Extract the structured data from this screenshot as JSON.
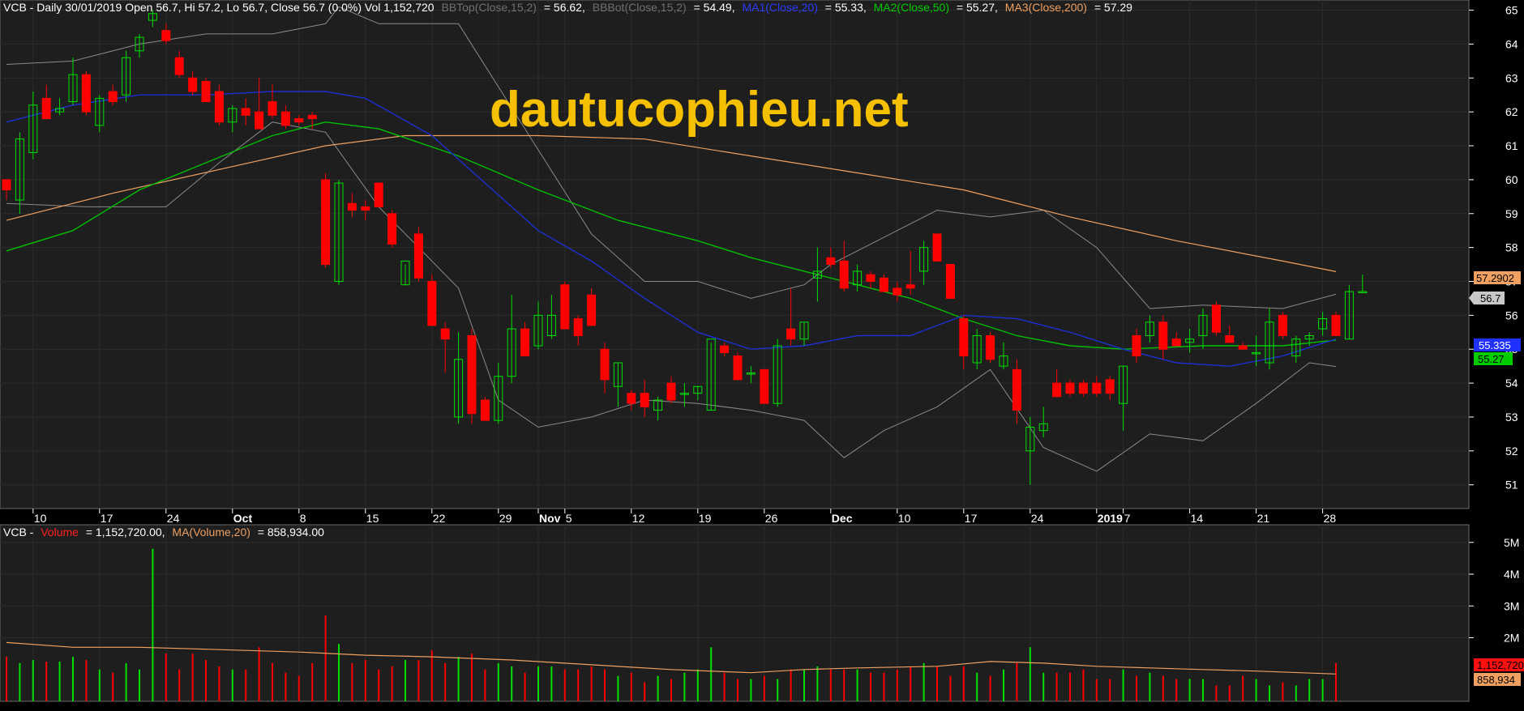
{
  "header": {
    "symbol": "VCB",
    "period": "Daily",
    "date": "30/01/2019",
    "ohlc_text": "VCB - Daily 30/01/2019 Open 56.7, Hi 57.2, Lo 56.7, Close 56.7 (0.0%) Vol 1,152,720",
    "bbtop_label": "BBTop(Close,15,2)",
    "bbtop_value": "= 56.62,",
    "bbbot_label": "BBBot(Close,15,2)",
    "bbbot_value": "= 54.49,",
    "ma1_label": "MA1(Close,20)",
    "ma1_value": "= 55.33,",
    "ma2_label": "MA2(Close,50)",
    "ma2_value": "= 55.27,",
    "ma3_label": "MA3(Close,200)",
    "ma3_value": "= 57.29"
  },
  "volume_header": {
    "prefix": "VCB -",
    "vol_label": "Volume",
    "vol_value": "= 1,152,720.00,",
    "ma_label": "MA(Volume,20)",
    "ma_value": "= 858,934.00"
  },
  "watermark": "dautucophieu.net",
  "badges": {
    "ma3": "57.2902",
    "close": "56.7",
    "ma1": "55.335",
    "ma2": "55.27",
    "vol": "1,152,720",
    "vol_ma": "858,934"
  },
  "colors": {
    "up": "#00e000",
    "down": "#ff0000",
    "ma1": "#1c2fd0",
    "ma2": "#00c000",
    "ma3": "#f0a060",
    "bb": "#8a8a8a",
    "watermark": "#f5c000",
    "badge_ma3": "#f0a060",
    "badge_ma1": "#2030ff",
    "badge_ma2": "#00cc00",
    "badge_close": "#c8c8c8"
  },
  "chart_data": {
    "type": "candlestick",
    "y_ticks": [
      "51",
      "52",
      "53",
      "54",
      "55",
      "56",
      "57",
      "58",
      "59",
      "60",
      "61",
      "62",
      "63",
      "64",
      "65"
    ],
    "y_range": [
      50.3,
      65.3
    ],
    "volume_ticks": [
      "2M",
      "3M",
      "4M",
      "5M"
    ],
    "volume_range": [
      0,
      5300000
    ],
    "x_labels": [
      {
        "i": 2,
        "t": "10"
      },
      {
        "i": 7,
        "t": "17"
      },
      {
        "i": 12,
        "t": "24"
      },
      {
        "i": 17,
        "t": "Oct",
        "bold": true
      },
      {
        "i": 22,
        "t": "8"
      },
      {
        "i": 27,
        "t": "15"
      },
      {
        "i": 32,
        "t": "22"
      },
      {
        "i": 37,
        "t": "29"
      },
      {
        "i": 40,
        "t": "Nov",
        "bold": true
      },
      {
        "i": 42,
        "t": "5"
      },
      {
        "i": 47,
        "t": "12"
      },
      {
        "i": 52,
        "t": "19"
      },
      {
        "i": 57,
        "t": "26"
      },
      {
        "i": 62,
        "t": "Dec",
        "bold": true
      },
      {
        "i": 67,
        "t": "10"
      },
      {
        "i": 72,
        "t": "17"
      },
      {
        "i": 77,
        "t": "24"
      },
      {
        "i": 82,
        "t": "2019",
        "bold": true
      },
      {
        "i": 84,
        "t": "7"
      },
      {
        "i": 89,
        "t": "14"
      },
      {
        "i": 94,
        "t": "21"
      },
      {
        "i": 99,
        "t": "28"
      }
    ],
    "candles": [
      [
        60.0,
        60.0,
        59.4,
        59.7
      ],
      [
        59.4,
        61.4,
        59.0,
        61.2
      ],
      [
        60.8,
        62.6,
        60.6,
        62.2
      ],
      [
        62.4,
        62.8,
        61.8,
        61.8
      ],
      [
        62.0,
        62.4,
        61.9,
        62.1
      ],
      [
        62.3,
        63.6,
        62.2,
        63.1
      ],
      [
        63.1,
        63.2,
        61.9,
        62.0
      ],
      [
        61.6,
        62.5,
        61.4,
        62.4
      ],
      [
        62.6,
        62.8,
        62.2,
        62.3
      ],
      [
        62.5,
        63.8,
        62.3,
        63.6
      ],
      [
        63.8,
        64.3,
        63.6,
        64.2
      ],
      [
        64.7,
        65.0,
        64.5,
        64.9
      ],
      [
        64.4,
        64.6,
        64.0,
        64.1
      ],
      [
        63.6,
        63.8,
        63.0,
        63.1
      ],
      [
        63.0,
        63.2,
        62.5,
        62.6
      ],
      [
        62.9,
        63.0,
        62.3,
        62.3
      ],
      [
        62.6,
        62.8,
        61.6,
        61.7
      ],
      [
        61.7,
        62.2,
        61.4,
        62.1
      ],
      [
        62.1,
        62.4,
        61.6,
        61.9
      ],
      [
        62.0,
        63.0,
        61.5,
        61.5
      ],
      [
        62.3,
        62.8,
        61.8,
        61.9
      ],
      [
        62.0,
        62.2,
        61.5,
        61.6
      ],
      [
        61.8,
        61.9,
        61.6,
        61.7
      ],
      [
        61.9,
        62.0,
        61.5,
        61.8
      ],
      [
        60.0,
        60.2,
        57.4,
        57.5
      ],
      [
        57.0,
        60.0,
        56.9,
        59.9
      ],
      [
        59.3,
        59.6,
        58.9,
        59.1
      ],
      [
        59.2,
        59.4,
        58.8,
        59.1
      ],
      [
        59.9,
        59.9,
        59.2,
        59.2
      ],
      [
        59.0,
        59.1,
        58.0,
        58.1
      ],
      [
        56.9,
        57.5,
        56.9,
        57.6
      ],
      [
        58.4,
        58.6,
        57.0,
        57.1
      ],
      [
        57.0,
        57.2,
        55.7,
        55.7
      ],
      [
        55.6,
        55.8,
        54.3,
        55.3
      ],
      [
        53.0,
        55.5,
        52.8,
        54.7
      ],
      [
        55.4,
        55.6,
        52.8,
        53.1
      ],
      [
        53.5,
        53.6,
        52.9,
        52.9
      ],
      [
        52.9,
        54.6,
        52.8,
        54.2
      ],
      [
        54.2,
        56.6,
        54.0,
        55.6
      ],
      [
        55.6,
        55.8,
        54.8,
        54.8
      ],
      [
        55.1,
        56.4,
        55.0,
        56.0
      ],
      [
        55.4,
        56.6,
        55.3,
        56.0
      ],
      [
        56.9,
        57.0,
        55.6,
        55.6
      ],
      [
        55.9,
        56.0,
        55.1,
        55.4
      ],
      [
        56.6,
        56.8,
        55.7,
        55.7
      ],
      [
        55.0,
        55.2,
        53.7,
        54.1
      ],
      [
        53.9,
        54.6,
        53.3,
        54.6
      ],
      [
        53.7,
        53.8,
        53.2,
        53.4
      ],
      [
        53.7,
        54.1,
        53.0,
        53.3
      ],
      [
        53.2,
        53.6,
        52.9,
        53.5
      ],
      [
        54.0,
        54.2,
        53.4,
        53.5
      ],
      [
        53.7,
        54.0,
        53.3,
        53.7
      ],
      [
        53.7,
        53.9,
        53.5,
        53.9
      ],
      [
        53.2,
        55.2,
        53.2,
        55.3
      ],
      [
        55.1,
        55.2,
        54.8,
        54.9
      ],
      [
        54.8,
        54.9,
        54.1,
        54.1
      ],
      [
        54.3,
        54.5,
        54.0,
        54.3
      ],
      [
        54.4,
        54.4,
        53.4,
        53.4
      ],
      [
        53.4,
        55.3,
        53.3,
        55.1
      ],
      [
        55.6,
        56.8,
        55.1,
        55.3
      ],
      [
        55.3,
        55.8,
        55.1,
        55.8
      ],
      [
        57.1,
        58.0,
        56.4,
        57.3
      ],
      [
        57.7,
        58.0,
        57.4,
        57.5
      ],
      [
        57.6,
        58.2,
        56.7,
        56.8
      ],
      [
        56.9,
        57.5,
        56.7,
        57.3
      ],
      [
        57.2,
        57.3,
        56.8,
        57.0
      ],
      [
        57.1,
        57.2,
        56.7,
        56.7
      ],
      [
        56.8,
        57.0,
        56.4,
        56.6
      ],
      [
        56.9,
        57.9,
        56.6,
        56.8
      ],
      [
        57.3,
        58.2,
        56.9,
        58.0
      ],
      [
        58.4,
        58.4,
        57.8,
        57.6
      ],
      [
        57.5,
        57.5,
        56.5,
        56.5
      ],
      [
        55.9,
        56.0,
        54.4,
        54.8
      ],
      [
        54.6,
        55.6,
        54.4,
        55.4
      ],
      [
        55.4,
        55.5,
        54.6,
        54.7
      ],
      [
        54.5,
        55.2,
        54.4,
        54.8
      ],
      [
        54.4,
        54.7,
        52.8,
        53.2
      ],
      [
        52.0,
        53.0,
        51.0,
        52.7
      ],
      [
        52.6,
        53.3,
        52.4,
        52.8
      ],
      [
        54.0,
        54.4,
        53.6,
        53.6
      ],
      [
        54.0,
        54.1,
        53.6,
        53.7
      ],
      [
        54.0,
        54.1,
        53.6,
        53.7
      ],
      [
        54.0,
        54.2,
        53.6,
        53.7
      ],
      [
        54.1,
        54.2,
        53.5,
        53.7
      ],
      [
        53.4,
        54.5,
        52.6,
        54.5
      ],
      [
        55.4,
        55.6,
        54.6,
        54.8
      ],
      [
        55.4,
        56.0,
        55.2,
        55.8
      ],
      [
        55.8,
        56.0,
        54.7,
        55.0
      ],
      [
        55.3,
        55.5,
        55.1,
        55.1
      ],
      [
        55.2,
        55.6,
        54.9,
        55.3
      ],
      [
        55.4,
        56.2,
        55.0,
        56.0
      ],
      [
        56.3,
        56.4,
        55.4,
        55.5
      ],
      [
        55.4,
        55.7,
        55.2,
        55.2
      ],
      [
        55.1,
        55.2,
        55.0,
        55.0
      ],
      [
        54.9,
        55.4,
        54.5,
        54.9
      ],
      [
        54.6,
        56.2,
        54.4,
        55.8
      ],
      [
        56.0,
        56.1,
        55.3,
        55.4
      ],
      [
        54.8,
        55.4,
        54.6,
        55.3
      ],
      [
        55.3,
        55.5,
        55.1,
        55.4
      ],
      [
        55.6,
        56.1,
        55.4,
        55.9
      ],
      [
        56.0,
        56.1,
        55.4,
        55.4
      ],
      [
        55.3,
        56.9,
        55.3,
        56.7
      ],
      [
        56.7,
        57.2,
        56.7,
        56.7
      ]
    ],
    "ma1": [
      [
        0,
        61.7
      ],
      [
        5,
        62.2
      ],
      [
        10,
        62.5
      ],
      [
        15,
        62.5
      ],
      [
        20,
        62.6
      ],
      [
        24,
        62.6
      ],
      [
        27,
        62.4
      ],
      [
        32,
        61.3
      ],
      [
        36,
        59.9
      ],
      [
        40,
        58.5
      ],
      [
        44,
        57.6
      ],
      [
        48,
        56.5
      ],
      [
        52,
        55.5
      ],
      [
        56,
        55.0
      ],
      [
        60,
        55.1
      ],
      [
        64,
        55.4
      ],
      [
        68,
        55.4
      ],
      [
        72,
        56.0
      ],
      [
        76,
        55.9
      ],
      [
        80,
        55.5
      ],
      [
        84,
        55.0
      ],
      [
        88,
        54.6
      ],
      [
        92,
        54.5
      ],
      [
        96,
        54.8
      ],
      [
        100,
        55.3
      ]
    ],
    "ma2": [
      [
        0,
        57.9
      ],
      [
        5,
        58.5
      ],
      [
        10,
        59.7
      ],
      [
        15,
        60.5
      ],
      [
        20,
        61.3
      ],
      [
        24,
        61.7
      ],
      [
        28,
        61.5
      ],
      [
        34,
        60.7
      ],
      [
        40,
        59.7
      ],
      [
        46,
        58.8
      ],
      [
        52,
        58.2
      ],
      [
        56,
        57.7
      ],
      [
        60,
        57.3
      ],
      [
        64,
        56.9
      ],
      [
        68,
        56.5
      ],
      [
        72,
        55.9
      ],
      [
        76,
        55.4
      ],
      [
        80,
        55.1
      ],
      [
        84,
        55.0
      ],
      [
        90,
        55.1
      ],
      [
        96,
        55.1
      ],
      [
        100,
        55.27
      ]
    ],
    "ma3": [
      [
        0,
        58.8
      ],
      [
        8,
        59.6
      ],
      [
        16,
        60.3
      ],
      [
        24,
        61.0
      ],
      [
        30,
        61.3
      ],
      [
        40,
        61.3
      ],
      [
        48,
        61.2
      ],
      [
        56,
        60.7
      ],
      [
        64,
        60.2
      ],
      [
        72,
        59.7
      ],
      [
        80,
        58.9
      ],
      [
        88,
        58.2
      ],
      [
        96,
        57.6
      ],
      [
        100,
        57.29
      ]
    ],
    "bbtop": [
      [
        0,
        63.4
      ],
      [
        5,
        63.5
      ],
      [
        10,
        64.0
      ],
      [
        15,
        64.3
      ],
      [
        20,
        64.3
      ],
      [
        24,
        64.6
      ],
      [
        25,
        65.1
      ],
      [
        28,
        64.6
      ],
      [
        34,
        64.6
      ],
      [
        39,
        61.5
      ],
      [
        44,
        58.4
      ],
      [
        48,
        57.0
      ],
      [
        52,
        57.0
      ],
      [
        56,
        56.5
      ],
      [
        60,
        56.9
      ],
      [
        62,
        57.5
      ],
      [
        66,
        58.3
      ],
      [
        70,
        59.1
      ],
      [
        74,
        58.9
      ],
      [
        78,
        59.1
      ],
      [
        82,
        58.0
      ],
      [
        86,
        56.2
      ],
      [
        90,
        56.3
      ],
      [
        96,
        56.2
      ],
      [
        100,
        56.62
      ]
    ],
    "bbbot": [
      [
        0,
        59.3
      ],
      [
        6,
        59.2
      ],
      [
        12,
        59.2
      ],
      [
        16,
        60.5
      ],
      [
        20,
        61.7
      ],
      [
        24,
        61.4
      ],
      [
        28,
        59.2
      ],
      [
        34,
        56.8
      ],
      [
        37,
        53.5
      ],
      [
        40,
        52.7
      ],
      [
        44,
        53.0
      ],
      [
        48,
        53.5
      ],
      [
        52,
        53.4
      ],
      [
        56,
        53.2
      ],
      [
        60,
        52.9
      ],
      [
        63,
        51.8
      ],
      [
        66,
        52.6
      ],
      [
        70,
        53.3
      ],
      [
        74,
        54.4
      ],
      [
        78,
        52.1
      ],
      [
        82,
        51.4
      ],
      [
        86,
        52.5
      ],
      [
        90,
        52.3
      ],
      [
        94,
        53.4
      ],
      [
        98,
        54.6
      ],
      [
        100,
        54.49
      ]
    ],
    "volume": [
      1400000,
      1200000,
      1300000,
      1250000,
      1250000,
      1400000,
      1300000,
      1000000,
      900000,
      1200000,
      1000000,
      4800000,
      1500000,
      1000000,
      1500000,
      1300000,
      1100000,
      1000000,
      1000000,
      1700000,
      1200000,
      900000,
      800000,
      1200000,
      2700000,
      1800000,
      1200000,
      1300000,
      1000000,
      1100000,
      1300000,
      1300000,
      1600000,
      1200000,
      1400000,
      1500000,
      1000000,
      1200000,
      1100000,
      900000,
      1100000,
      1100000,
      1000000,
      1000000,
      1100000,
      1000000,
      800000,
      900000,
      600000,
      800000,
      700000,
      900000,
      1000000,
      1700000,
      900000,
      700000,
      700000,
      800000,
      700000,
      1000000,
      1000000,
      1100000,
      1000000,
      1000000,
      1000000,
      900000,
      900000,
      1000000,
      1100000,
      1200000,
      1100000,
      800000,
      1100000,
      900000,
      800000,
      1000000,
      1200000,
      1700000,
      900000,
      900000,
      900000,
      1000000,
      700000,
      700000,
      1000000,
      800000,
      900000,
      800000,
      700000,
      700000,
      700000,
      500000,
      500000,
      800000,
      700000,
      500000,
      600000,
      500000,
      700000,
      700000,
      1200000
    ],
    "vol_ma": [
      [
        0,
        1850000
      ],
      [
        5,
        1700000
      ],
      [
        10,
        1700000
      ],
      [
        14,
        1650000
      ],
      [
        18,
        1600000
      ],
      [
        22,
        1550000
      ],
      [
        27,
        1450000
      ],
      [
        32,
        1400000
      ],
      [
        38,
        1300000
      ],
      [
        44,
        1150000
      ],
      [
        50,
        1000000
      ],
      [
        56,
        900000
      ],
      [
        60,
        1000000
      ],
      [
        64,
        1050000
      ],
      [
        70,
        1100000
      ],
      [
        74,
        1250000
      ],
      [
        78,
        1200000
      ],
      [
        82,
        1100000
      ],
      [
        86,
        1050000
      ],
      [
        90,
        1000000
      ],
      [
        94,
        950000
      ],
      [
        100,
        859000
      ]
    ]
  }
}
